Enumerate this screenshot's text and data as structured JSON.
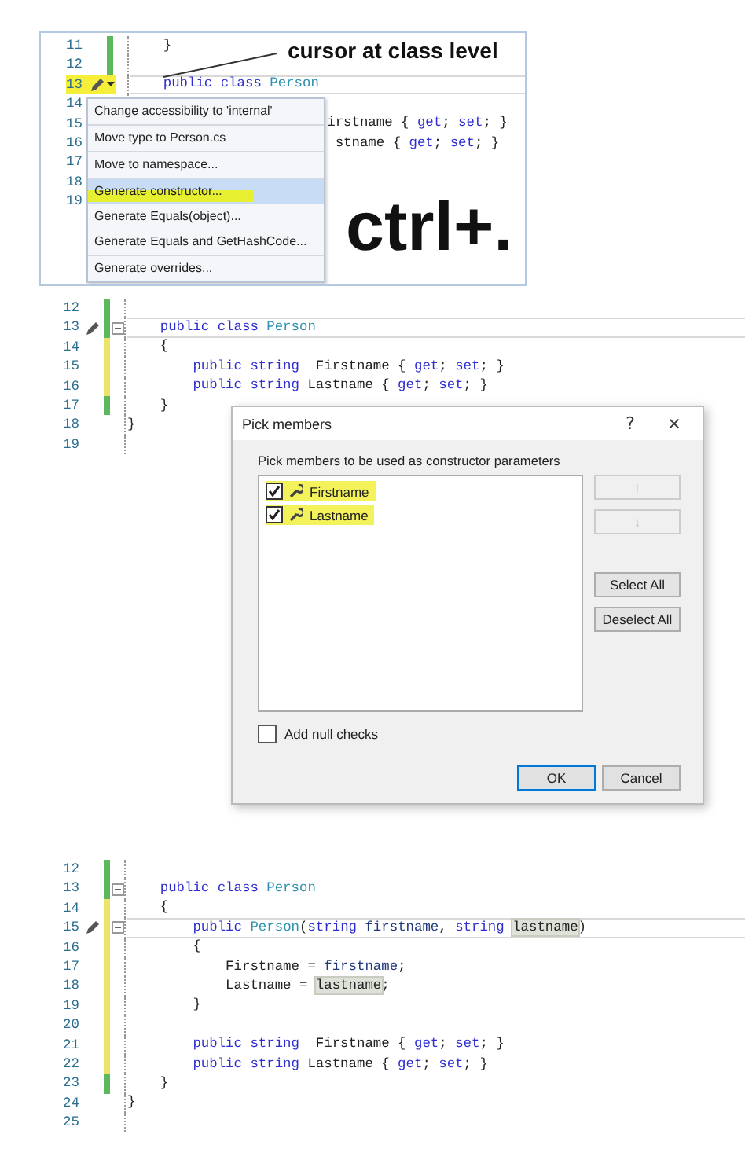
{
  "step1": {
    "lines": [
      {
        "number": "11",
        "color": "#5cb85c",
        "segments": [
          {
            "text": "    }",
            "kind": "plain"
          }
        ]
      },
      {
        "number": "12",
        "color": "#5cb85c"
      },
      {
        "number": "13",
        "quick_actions": true,
        "current": true,
        "segments": [
          {
            "text": "    public class",
            "kind": "kw"
          },
          {
            "text": " Person",
            "kind": "type"
          }
        ]
      },
      {
        "number": "14"
      },
      {
        "number": "15",
        "covered": true,
        "segments": [
          {
            "text": "irstname { ",
            "kind": "plain"
          },
          {
            "text": "get",
            "kind": "kw"
          },
          {
            "text": "; ",
            "kind": "plain"
          },
          {
            "text": "set",
            "kind": "kw"
          },
          {
            "text": "; }",
            "kind": "plain"
          }
        ]
      },
      {
        "number": "16",
        "covered": true,
        "segments": [
          {
            "text": " stname { ",
            "kind": "plain"
          },
          {
            "text": "get",
            "kind": "kw"
          },
          {
            "text": "; ",
            "kind": "plain"
          },
          {
            "text": "set",
            "kind": "kw"
          },
          {
            "text": "; }",
            "kind": "plain"
          }
        ]
      },
      {
        "number": "17"
      },
      {
        "number": "18"
      },
      {
        "number": "19"
      }
    ],
    "menu": [
      {
        "label": "Change accessibility to 'internal'",
        "selected": false,
        "highlighted": false,
        "separator": true
      },
      {
        "label": "Move type to Person.cs",
        "selected": false,
        "highlighted": false,
        "separator": true
      },
      {
        "label": "Move to namespace...",
        "selected": false,
        "highlighted": false,
        "separator": true
      },
      {
        "label": "Generate constructor...",
        "selected": true,
        "highlighted": true,
        "separator": false
      },
      {
        "label": "Generate Equals(object)...",
        "selected": false,
        "highlighted": false,
        "separator": false
      },
      {
        "label": "Generate Equals and GetHashCode...",
        "selected": false,
        "highlighted": false,
        "separator": true
      },
      {
        "label": "Generate overrides...",
        "selected": false,
        "highlighted": false,
        "separator": false
      }
    ],
    "callout": "cursor at class level",
    "shortcut": "ctrl+."
  },
  "step2": {
    "lines": [
      {
        "number": "12",
        "color": "#5cb85c"
      },
      {
        "number": "13",
        "color": "#5cb85c",
        "pencil": true,
        "current": true,
        "fold": true,
        "segments": [
          {
            "text": "    public class",
            "kind": "kw"
          },
          {
            "text": " Person",
            "kind": "type"
          }
        ]
      },
      {
        "number": "14",
        "color": "#eee36a",
        "segments": [
          {
            "text": "    {",
            "kind": "plain"
          }
        ]
      },
      {
        "number": "15",
        "color": "#eee36a",
        "segments": [
          {
            "text": "        public string",
            "kind": "kw"
          },
          {
            "text": "  Firstname { ",
            "kind": "plain"
          },
          {
            "text": "get",
            "kind": "kw"
          },
          {
            "text": "; ",
            "kind": "plain"
          },
          {
            "text": "set",
            "kind": "kw"
          },
          {
            "text": "; }",
            "kind": "plain"
          }
        ]
      },
      {
        "number": "16",
        "color": "#eee36a",
        "segments": [
          {
            "text": "        public string",
            "kind": "kw"
          },
          {
            "text": " Lastname { ",
            "kind": "plain"
          },
          {
            "text": "get",
            "kind": "kw"
          },
          {
            "text": "; ",
            "kind": "plain"
          },
          {
            "text": "set",
            "kind": "kw"
          },
          {
            "text": "; }",
            "kind": "plain"
          }
        ]
      },
      {
        "number": "17",
        "color": "#5cb85c",
        "segments": [
          {
            "text": "    }",
            "kind": "plain"
          }
        ]
      },
      {
        "number": "18",
        "segments": [
          {
            "text": "}",
            "kind": "plain"
          }
        ]
      },
      {
        "number": "19"
      }
    ],
    "dialog": {
      "title": "Pick members",
      "help": "?",
      "close": "×",
      "instruction": "Pick members to be used as constructor parameters",
      "members": [
        {
          "name": "Firstname",
          "checked": true,
          "highlighted": true
        },
        {
          "name": "Lastname",
          "checked": true,
          "highlighted": true
        }
      ],
      "move_buttons": [
        {
          "label": "↑",
          "disabled": true
        },
        {
          "label": "↓",
          "disabled": true
        }
      ],
      "side_buttons": [
        "Select All",
        "Deselect All"
      ],
      "option": {
        "label": "Add null checks",
        "checked": false
      },
      "buttons": [
        {
          "label": "OK",
          "default": true
        },
        {
          "label": "Cancel",
          "default": false
        }
      ]
    }
  },
  "step3": {
    "lines": [
      {
        "number": "12",
        "color": "#5cb85c"
      },
      {
        "number": "13",
        "color": "#5cb85c",
        "fold": true,
        "segments": [
          {
            "text": "    public class",
            "kind": "kw"
          },
          {
            "text": " Person",
            "kind": "type"
          }
        ]
      },
      {
        "number": "14",
        "color": "#eee36a",
        "segments": [
          {
            "text": "    {",
            "kind": "plain"
          }
        ]
      },
      {
        "number": "15",
        "color": "#eee36a",
        "pencil": true,
        "current": true,
        "fold": true,
        "segments": [
          {
            "text": "        public",
            "kind": "kw"
          },
          {
            "text": " Person",
            "kind": "type"
          },
          {
            "text": "(",
            "kind": "plain"
          },
          {
            "text": "string",
            "kind": "kw"
          },
          {
            "text": " firstname",
            "kind": "param"
          },
          {
            "text": ", ",
            "kind": "plain"
          },
          {
            "text": "string ",
            "kind": "kw"
          },
          {
            "text": "lastname",
            "kind": "ref"
          },
          {
            "text": ")",
            "kind": "plain"
          }
        ]
      },
      {
        "number": "16",
        "color": "#eee36a",
        "segments": [
          {
            "text": "        {",
            "kind": "plain"
          }
        ]
      },
      {
        "number": "17",
        "color": "#eee36a",
        "segments": [
          {
            "text": "            Firstname = ",
            "kind": "plain"
          },
          {
            "text": "firstname",
            "kind": "param"
          },
          {
            "text": ";",
            "kind": "plain"
          }
        ]
      },
      {
        "number": "18",
        "color": "#eee36a",
        "segments": [
          {
            "text": "            Lastname = ",
            "kind": "plain"
          },
          {
            "text": "lastname",
            "kind": "ref"
          },
          {
            "text": ";",
            "kind": "plain"
          }
        ]
      },
      {
        "number": "19",
        "color": "#eee36a",
        "segments": [
          {
            "text": "        }",
            "kind": "plain"
          }
        ]
      },
      {
        "number": "20",
        "color": "#eee36a"
      },
      {
        "number": "21",
        "color": "#eee36a",
        "segments": [
          {
            "text": "        public string",
            "kind": "kw"
          },
          {
            "text": "  Firstname { ",
            "kind": "plain"
          },
          {
            "text": "get",
            "kind": "kw"
          },
          {
            "text": "; ",
            "kind": "plain"
          },
          {
            "text": "set",
            "kind": "kw"
          },
          {
            "text": "; }",
            "kind": "plain"
          }
        ]
      },
      {
        "number": "22",
        "color": "#eee36a",
        "segments": [
          {
            "text": "        public string",
            "kind": "kw"
          },
          {
            "text": " Lastname { ",
            "kind": "plain"
          },
          {
            "text": "get",
            "kind": "kw"
          },
          {
            "text": "; ",
            "kind": "plain"
          },
          {
            "text": "set",
            "kind": "kw"
          },
          {
            "text": "; }",
            "kind": "plain"
          }
        ]
      },
      {
        "number": "23",
        "color": "#5cb85c",
        "segments": [
          {
            "text": "    }",
            "kind": "plain"
          }
        ]
      },
      {
        "number": "24",
        "segments": [
          {
            "text": "}",
            "kind": "plain"
          }
        ]
      },
      {
        "number": "25"
      }
    ]
  }
}
